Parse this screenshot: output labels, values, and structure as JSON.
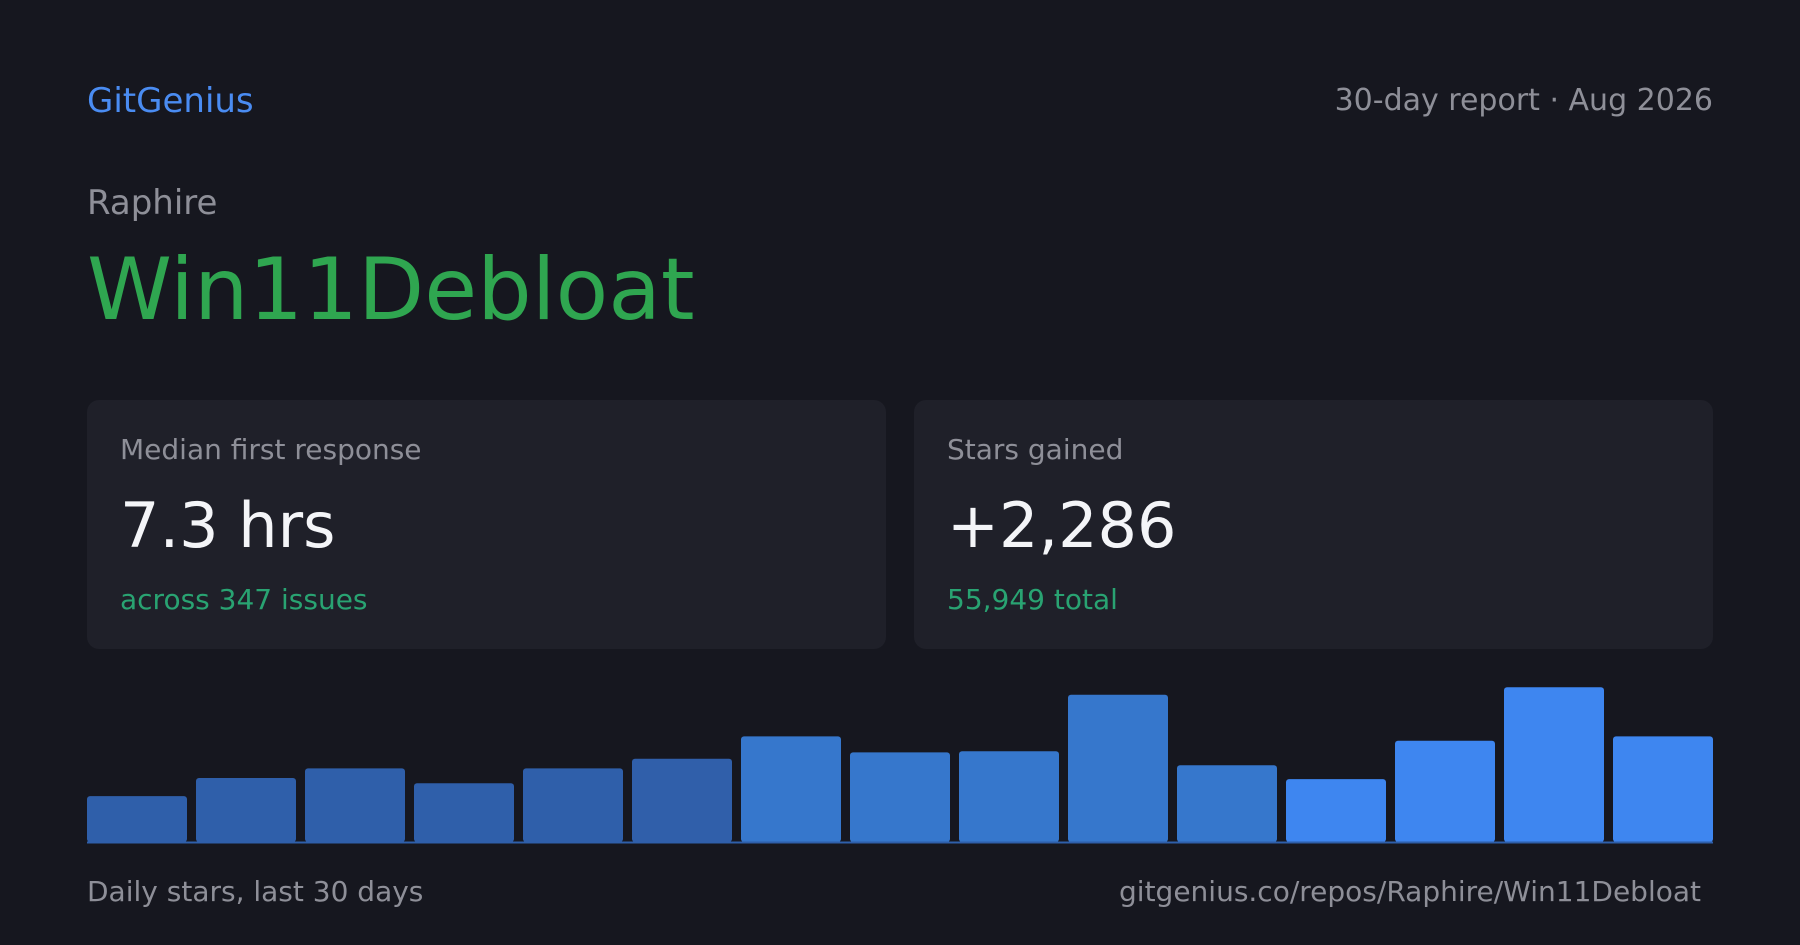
{
  "brand": "GitGenius",
  "report_label": "30-day report · Aug 2026",
  "owner": "Raphire",
  "repo_name": "Win11Debloat",
  "cards": {
    "response": {
      "label": "Median first response",
      "value": "7.3 hrs",
      "sub": "across 347 issues"
    },
    "stars": {
      "label": "Stars gained",
      "value": "+2,286",
      "sub": "55,949 total"
    }
  },
  "footer": {
    "caption": "Daily stars, last 30 days",
    "url": "gitgenius.co/repos/Raphire/Win11Debloat"
  },
  "colors": {
    "brand": "#4a8cf2",
    "repo": "#2fa650",
    "accent_sub": "#29a372",
    "bar_shades": [
      "#2f5faa",
      "#2f5faa",
      "#2f5faa",
      "#2f5faa",
      "#2f5faa",
      "#305faa",
      "#3677cc",
      "#3677cc",
      "#3677cc",
      "#3677cc",
      "#3677cc",
      "#3e86f0",
      "#3e86f0",
      "#3e86f0",
      "#3e86f0"
    ]
  },
  "chart_data": {
    "type": "bar",
    "title": "",
    "xlabel": "",
    "ylabel": "",
    "values": [
      43,
      60,
      69,
      55,
      69,
      78,
      99,
      84,
      85,
      138,
      72,
      59,
      95,
      145,
      99
    ],
    "ylim": [
      0,
      150
    ]
  }
}
